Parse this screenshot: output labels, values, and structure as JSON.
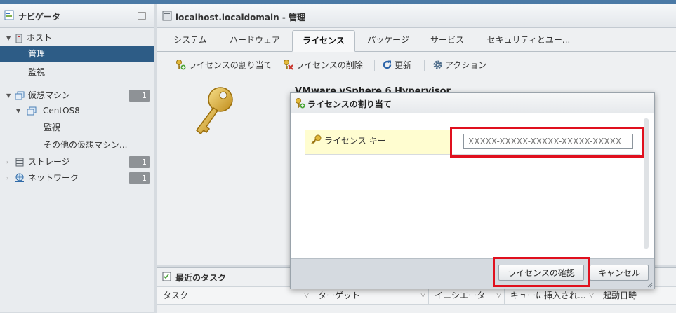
{
  "navigator": {
    "title": "ナビゲータ",
    "items": [
      {
        "label": "ホスト"
      },
      {
        "label": "管理"
      },
      {
        "label": "監視"
      },
      {
        "label": "仮想マシン",
        "badge": "1"
      },
      {
        "label": "CentOS8"
      },
      {
        "label": "監視"
      },
      {
        "label": "その他の仮想マシン..."
      },
      {
        "label": "ストレージ",
        "badge": "1"
      },
      {
        "label": "ネットワーク",
        "badge": "1"
      }
    ]
  },
  "main": {
    "title": "localhost.localdomain - 管理",
    "tabs": [
      {
        "label": "システム"
      },
      {
        "label": "ハードウェア"
      },
      {
        "label": "ライセンス",
        "active": true
      },
      {
        "label": "パッケージ"
      },
      {
        "label": "サービス"
      },
      {
        "label": "セキュリティとユー..."
      }
    ],
    "toolbar": {
      "assign_license": "ライセンスの割り当て",
      "remove_license": "ライセンスの削除",
      "refresh": "更新",
      "actions": "アクション"
    },
    "product_name": "VMware vSphere 6 Hypervisor"
  },
  "tasks": {
    "title": "最近のタスク",
    "columns": [
      "タスク",
      "ターゲット",
      "イニシエータ",
      "キューに挿入され...",
      "起動日時"
    ]
  },
  "modal": {
    "title": "ライセンスの割り当て",
    "field_label": "ライセンス キー",
    "field_placeholder": "XXXXX-XXXXX-XXXXX-XXXXX-XXXXX",
    "confirm_label": "ライセンスの確認",
    "cancel_label": "キャンセル"
  },
  "colors": {
    "accent": "#2d5c86",
    "highlight": "#e0101e"
  }
}
